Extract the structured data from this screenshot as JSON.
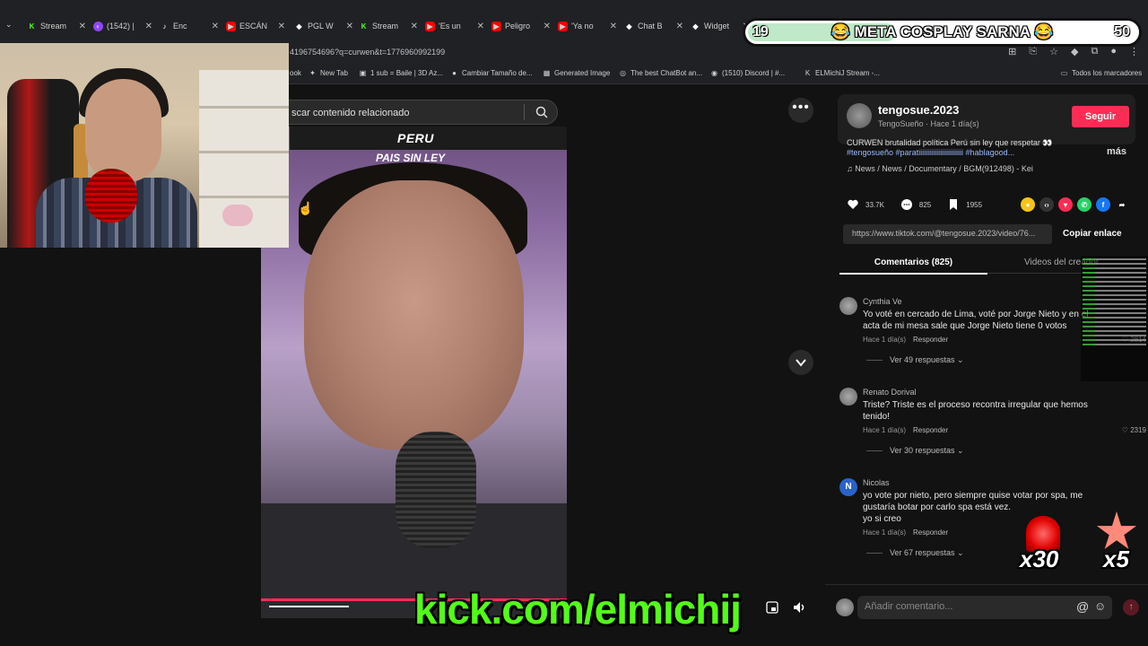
{
  "browser": {
    "tabs": [
      {
        "label": "Stream",
        "icon": "kick"
      },
      {
        "label": "(1542) |",
        "icon": "twitch"
      },
      {
        "label": "Enc",
        "icon": "tiktok"
      },
      {
        "label": "ESCÁN",
        "icon": "youtube"
      },
      {
        "label": "PGL W",
        "icon": "dia"
      },
      {
        "label": "Stream",
        "icon": "kick"
      },
      {
        "label": "'Es un",
        "icon": "youtube"
      },
      {
        "label": "Peligro",
        "icon": "youtube"
      },
      {
        "label": "'Ya no",
        "icon": "youtube"
      },
      {
        "label": "Chat B",
        "icon": "dia"
      },
      {
        "label": "Widget",
        "icon": "dia"
      }
    ],
    "url": "4196754696?q=curwen&t=1776960992199",
    "bookmarks": [
      "ook",
      "New Tab",
      "1 sub = Baile | 3D Az...",
      "Cambiar Tamaño de...",
      "Generated Image",
      "The best ChatBot an...",
      "(1510) Discord | #...",
      "ELMichiJ Stream -..."
    ],
    "all_bookmarks": "Todos los marcadores"
  },
  "video": {
    "search_placeholder": "scar contenido relacionado",
    "caption_line1": "PERU",
    "caption_line2": "PAIS SIN LEY",
    "progress": 0.26
  },
  "post": {
    "username": "tengosue.2023",
    "subtitle": "TengoSueño · Hace 1 día(s)",
    "follow_label": "Seguir",
    "description": "CURWEN brutalidad política Perú sin ley que respetar 👀",
    "hashtags": "#tengosueño #paratiiiiiiiiiiiiiiiiiiiiiiiii #hablagood...",
    "more_label": "más",
    "music": "News / News / Documentary / BGM(912498) - Kei",
    "likes": "33.7K",
    "comments_count": "825",
    "saves": "1955",
    "link": "https://www.tiktok.com/@tengosue.2023/video/76...",
    "copy_label": "Copiar enlace",
    "tab_comments": "Comentarios (825)",
    "tab_videos": "Videos del creador"
  },
  "comments": [
    {
      "name": "Cynthia Ve",
      "text": "Yo voté en cercado de Lima, voté por Jorge Nieto y en el acta de mi mesa sale que Jorge Nieto tiene 0 votos",
      "time": "Hace 1 día(s)",
      "reply": "Responder",
      "likes": "2814",
      "replies": "Ver 49 respuestas"
    },
    {
      "name": "Renato Dorival",
      "text": "Triste? Triste es el proceso recontra irregular que hemos tenido!",
      "time": "Hace 1 día(s)",
      "reply": "Responder",
      "likes": "2319",
      "replies": "Ver 30 respuestas"
    },
    {
      "name": "Nicolas",
      "initial": "N",
      "text": "yo vote por nieto, pero siempre quise votar por spa, me gustaría botar por carlo spa está vez.\nyo si creo",
      "time": "Hace 1 día(s)",
      "reply": "Responder",
      "likes": "",
      "replies": "Ver 67 respuestas"
    }
  ],
  "add_comment_placeholder": "Añadir comentario...",
  "overlay": {
    "goal_current": "19",
    "goal_title": "😂 META COSPLAY SARNA 😂",
    "goal_target": "50",
    "goal_progress": 0.38,
    "kick_url": "kick.com/elmichij",
    "multiplier1": "x30",
    "multiplier2": "x5"
  },
  "colors": {
    "accent": "#fe2c55",
    "kick_green": "#53fc18",
    "background": "#121212"
  }
}
